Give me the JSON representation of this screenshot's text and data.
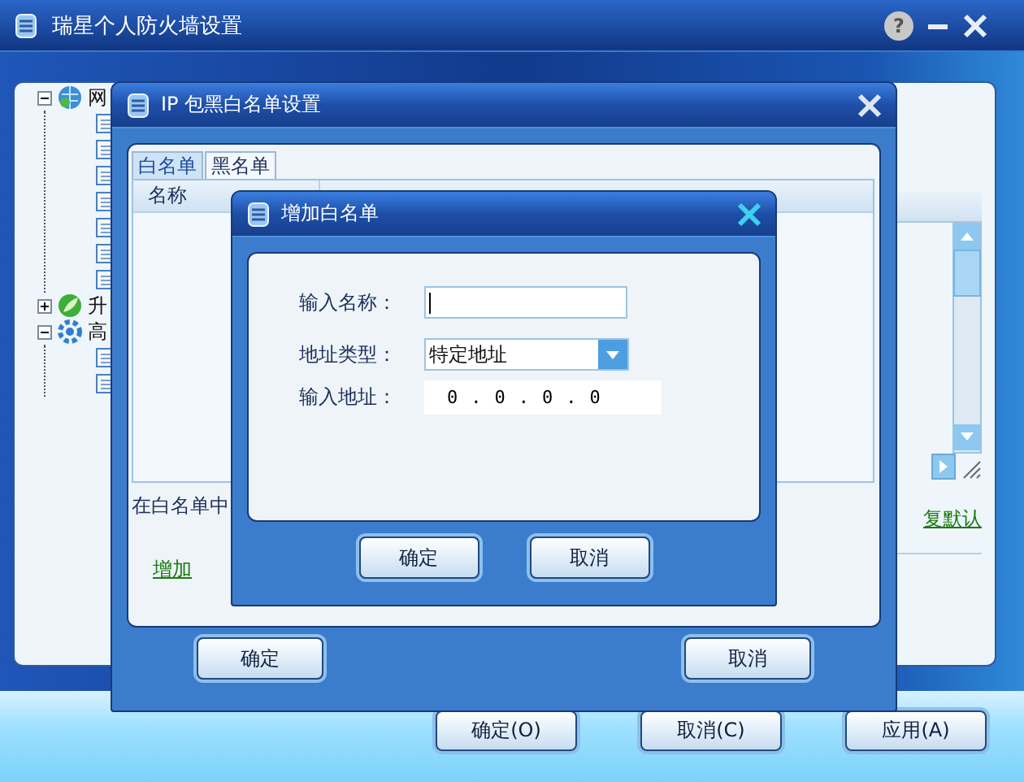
{
  "window": {
    "title": "瑞星个人防火墙设置",
    "help": "?"
  },
  "tree": [
    {
      "kind": "globe",
      "label": "网",
      "expanded": true,
      "children": [
        {
          "kind": "page"
        },
        {
          "kind": "page"
        },
        {
          "kind": "page"
        },
        {
          "kind": "page"
        },
        {
          "kind": "page"
        },
        {
          "kind": "page"
        },
        {
          "kind": "page"
        }
      ]
    },
    {
      "kind": "leaf",
      "label": "升",
      "expanded": false
    },
    {
      "kind": "gear",
      "label": "高",
      "expanded": true,
      "children": [
        {
          "kind": "page"
        },
        {
          "kind": "page"
        }
      ]
    }
  ],
  "side_panel": {
    "link": "复默认"
  },
  "buttons": [
    "确定(O)",
    "取消(C)",
    "应用(A)"
  ],
  "ip_dialog": {
    "title": "IP 包黑白名单设置",
    "tabs": [
      {
        "label": "白名单",
        "selected": true
      },
      {
        "label": "黑名单",
        "selected": false
      }
    ],
    "list": {
      "columns": [
        "名称"
      ]
    },
    "note": "在白名单中",
    "add_link": "增加",
    "buttons": [
      "确定",
      "取消"
    ]
  },
  "add_dialog": {
    "title": "增加白名单",
    "fields": [
      {
        "kind": "text",
        "label": "输入名称：",
        "focused": true
      },
      {
        "kind": "select",
        "label": "地址类型：",
        "value": "特定地址"
      },
      {
        "kind": "ip",
        "label": "输入地址：",
        "octets": [
          "0",
          "0",
          "0",
          "0"
        ],
        "separator": "."
      }
    ],
    "buttons": [
      "确定",
      "取消"
    ]
  }
}
